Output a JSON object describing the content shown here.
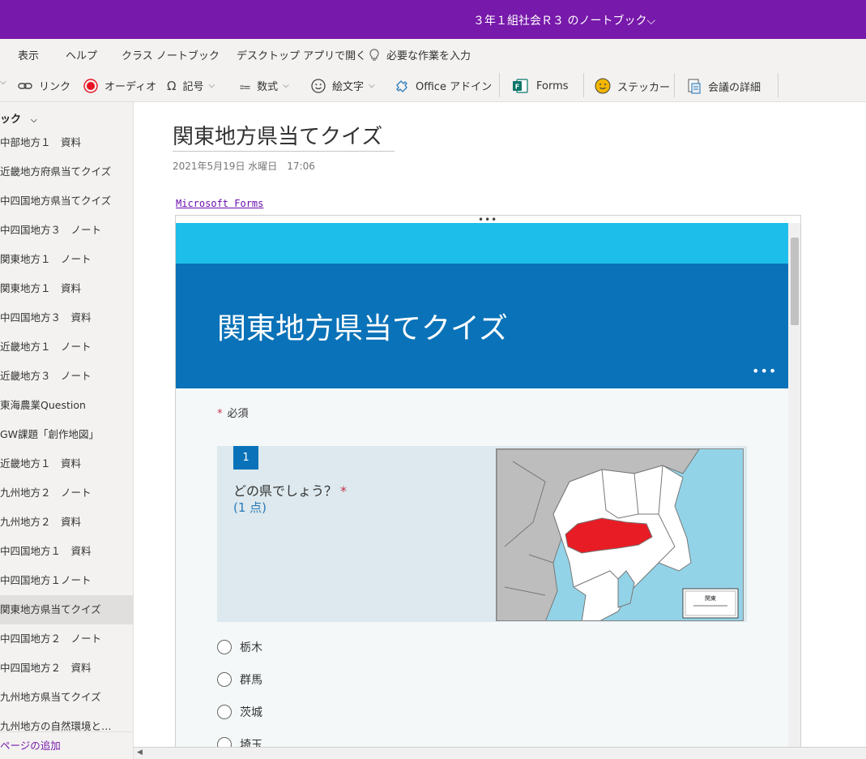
{
  "titlebar": {
    "notebook_title": "３年１組社会Ｒ３ のノートブック⌵"
  },
  "menu": {
    "view": "表示",
    "help": "ヘルプ",
    "class_notebook": "クラス ノートブック",
    "open_desktop": "デスクトップ アプリで開く",
    "tell_me": "必要な作業を入力"
  },
  "ribbon": {
    "link": "リンク",
    "audio": "オーディオ",
    "symbol": "記号",
    "equation": "数式",
    "emoji": "絵文字",
    "office_addins": "Office アドイン",
    "forms": "Forms",
    "sticker": "ステッカー",
    "meeting_details": "会議の詳細",
    "colors": {
      "audio_icon": "#e81123",
      "forms_icon": "#077568",
      "sticker_icon": "#f2b600"
    }
  },
  "nav": {
    "section_label": "ック",
    "items": [
      "中部地方１　資料",
      "近畿地方府県当てクイズ",
      "中四国地方県当てクイズ",
      "中四国地方３　ノート",
      "関東地方１　ノート",
      "関東地方１　資料",
      "中四国地方３　資料",
      "近畿地方１　ノート",
      "近畿地方３　ノート",
      "東海農業Question",
      "GW課題「創作地図」",
      "近畿地方１　資料",
      "九州地方２　ノート",
      "九州地方２　資料",
      "中四国地方１　資料",
      "中四国地方１ノート",
      "関東地方県当てクイズ",
      "中四国地方２　ノート",
      "中四国地方２　資料",
      "九州地方県当てクイズ",
      "九州地方の自然環境と…"
    ],
    "selected_index": 16,
    "add_page": "ページの追加"
  },
  "page": {
    "title": "関東地方県当てクイズ",
    "date": "2021年5月19日 水曜日　17:06",
    "forms_link": "Microsoft Forms"
  },
  "form": {
    "title": "関東地方県当てクイズ",
    "required_label": "必須",
    "question": {
      "number": "1",
      "text": "どの県でしょう？",
      "points": "(1 点)",
      "map_legend": "関東"
    },
    "options": [
      "栃木",
      "群馬",
      "茨城",
      "埼玉"
    ],
    "colors": {
      "header": "#0a72b8",
      "header_light": "#1ebeea",
      "highlight_prefecture": "#e81c24"
    }
  }
}
